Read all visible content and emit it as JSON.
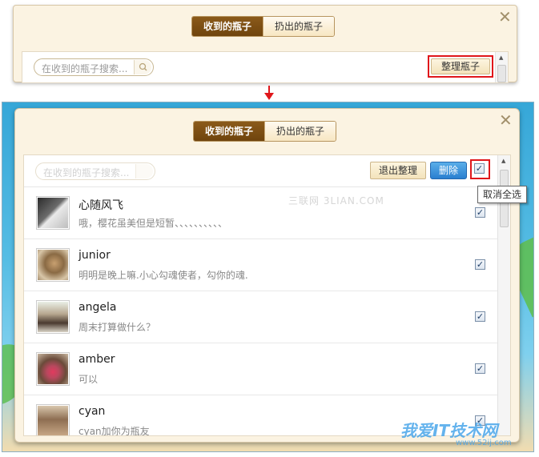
{
  "colors": {
    "accent_brown": "#7a4c12",
    "highlight_red": "#e0171b",
    "delete_blue": "#2f86d6"
  },
  "panel_top": {
    "tabs": [
      {
        "label": "收到的瓶子",
        "active": true
      },
      {
        "label": "扔出的瓶子",
        "active": false
      }
    ],
    "search_placeholder": "在收到的瓶子搜索...",
    "tidy_button": "整理瓶子",
    "close_icon": "close-icon"
  },
  "panel_bottom": {
    "tabs": [
      {
        "label": "收到的瓶子",
        "active": true
      },
      {
        "label": "扔出的瓶子",
        "active": false
      }
    ],
    "search_placeholder": "在收到的瓶子搜索...",
    "exit_button": "退出整理",
    "delete_button": "删除",
    "select_all_checked": true,
    "tooltip": "取消全选",
    "watermark": "三联网 3LIAN.COM",
    "items": [
      {
        "name": "心随风飞",
        "message": "哦，樱花虽美但是短暂、、、、、、、、、、",
        "checked": true
      },
      {
        "name": "junior",
        "message": "明明是晚上嘛.小心勾魂使者，勾你的魂.",
        "checked": true
      },
      {
        "name": "angela",
        "message": "周末打算做什么？",
        "checked": true
      },
      {
        "name": "amber",
        "message": "可以",
        "checked": true
      },
      {
        "name": "cyan",
        "message": "cyan加你为瓶友",
        "checked": true
      }
    ]
  },
  "brand": {
    "title": "我爱IT技术网",
    "url": "www.52ij.com"
  }
}
